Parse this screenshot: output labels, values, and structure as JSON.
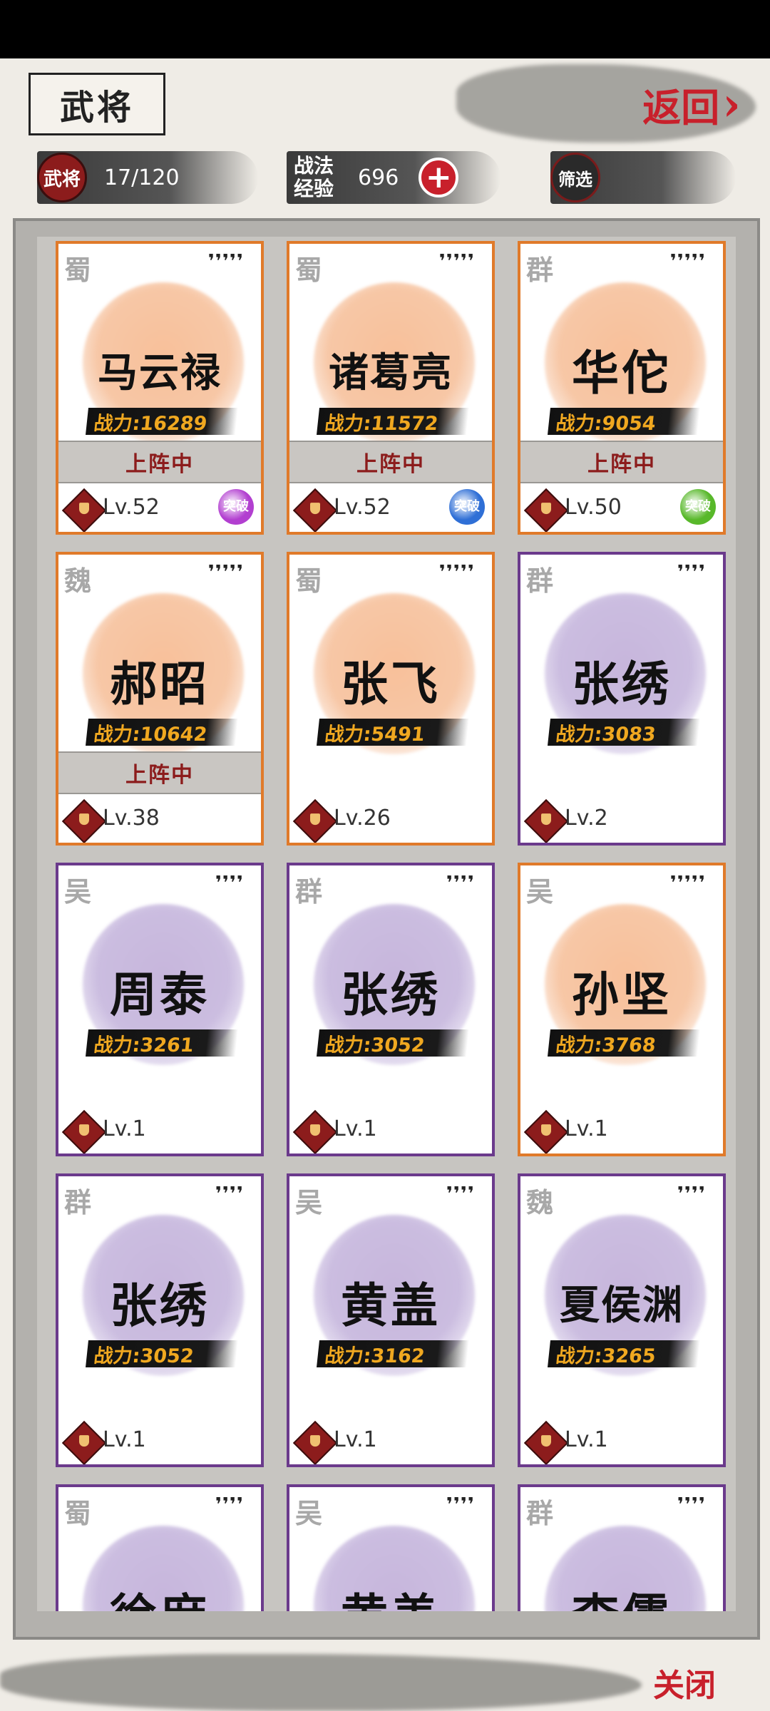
{
  "header": {
    "title": "武将",
    "back_label": "返回",
    "back_chevron": "›"
  },
  "stats": {
    "generals_badge": "武将",
    "generals_count": "17/120",
    "exp_label_line1": "战法",
    "exp_label_line2": "经验",
    "exp_value": "696",
    "filter_label": "筛选"
  },
  "cards": [
    {
      "kingdom": "蜀",
      "stars": "❜❜❜❜❜",
      "name": "马云禄",
      "power": "战力:16289",
      "deployed": "上阵中",
      "level": "Lv.52",
      "breakthrough": "突破",
      "breakthrough_color": "#b23fd0",
      "rarity": "orange"
    },
    {
      "kingdom": "蜀",
      "stars": "❜❜❜❜❜",
      "name": "诸葛亮",
      "power": "战力:11572",
      "deployed": "上阵中",
      "level": "Lv.52",
      "breakthrough": "突破",
      "breakthrough_color": "#2f6fd6",
      "rarity": "orange"
    },
    {
      "kingdom": "群",
      "stars": "❜❜❜❜❜",
      "name": "华佗",
      "power": "战力:9054",
      "deployed": "上阵中",
      "level": "Lv.50",
      "breakthrough": "突破",
      "breakthrough_color": "#58b82a",
      "rarity": "orange"
    },
    {
      "kingdom": "魏",
      "stars": "❜❜❜❜❜",
      "name": "郝昭",
      "power": "战力:10642",
      "deployed": "上阵中",
      "level": "Lv.38",
      "breakthrough": "",
      "rarity": "orange"
    },
    {
      "kingdom": "蜀",
      "stars": "❜❜❜❜❜",
      "name": "张飞",
      "power": "战力:5491",
      "deployed": "",
      "level": "Lv.26",
      "breakthrough": "",
      "rarity": "orange"
    },
    {
      "kingdom": "群",
      "stars": "❜❜❜❜",
      "name": "张绣",
      "power": "战力:3083",
      "deployed": "",
      "level": "Lv.2",
      "breakthrough": "",
      "rarity": "purple"
    },
    {
      "kingdom": "吴",
      "stars": "❜❜❜❜",
      "name": "周泰",
      "power": "战力:3261",
      "deployed": "",
      "level": "Lv.1",
      "breakthrough": "",
      "rarity": "purple"
    },
    {
      "kingdom": "群",
      "stars": "❜❜❜❜",
      "name": "张绣",
      "power": "战力:3052",
      "deployed": "",
      "level": "Lv.1",
      "breakthrough": "",
      "rarity": "purple"
    },
    {
      "kingdom": "吴",
      "stars": "❜❜❜❜❜",
      "name": "孙坚",
      "power": "战力:3768",
      "deployed": "",
      "level": "Lv.1",
      "breakthrough": "",
      "rarity": "orange"
    },
    {
      "kingdom": "群",
      "stars": "❜❜❜❜",
      "name": "张绣",
      "power": "战力:3052",
      "deployed": "",
      "level": "Lv.1",
      "breakthrough": "",
      "rarity": "purple"
    },
    {
      "kingdom": "吴",
      "stars": "❜❜❜❜",
      "name": "黄盖",
      "power": "战力:3162",
      "deployed": "",
      "level": "Lv.1",
      "breakthrough": "",
      "rarity": "purple"
    },
    {
      "kingdom": "魏",
      "stars": "❜❜❜❜",
      "name": "夏侯渊",
      "power": "战力:3265",
      "deployed": "",
      "level": "Lv.1",
      "breakthrough": "",
      "rarity": "purple"
    },
    {
      "kingdom": "蜀",
      "stars": "❜❜❜❜",
      "name": "徐庶",
      "power": "",
      "deployed": "",
      "level": "",
      "breakthrough": "",
      "rarity": "purple"
    },
    {
      "kingdom": "吴",
      "stars": "❜❜❜❜",
      "name": "黄盖",
      "power": "",
      "deployed": "",
      "level": "",
      "breakthrough": "",
      "rarity": "purple"
    },
    {
      "kingdom": "群",
      "stars": "❜❜❜❜",
      "name": "李儒",
      "power": "",
      "deployed": "",
      "level": "",
      "breakthrough": "",
      "rarity": "purple"
    }
  ],
  "footer": {
    "close_label": "关闭"
  }
}
